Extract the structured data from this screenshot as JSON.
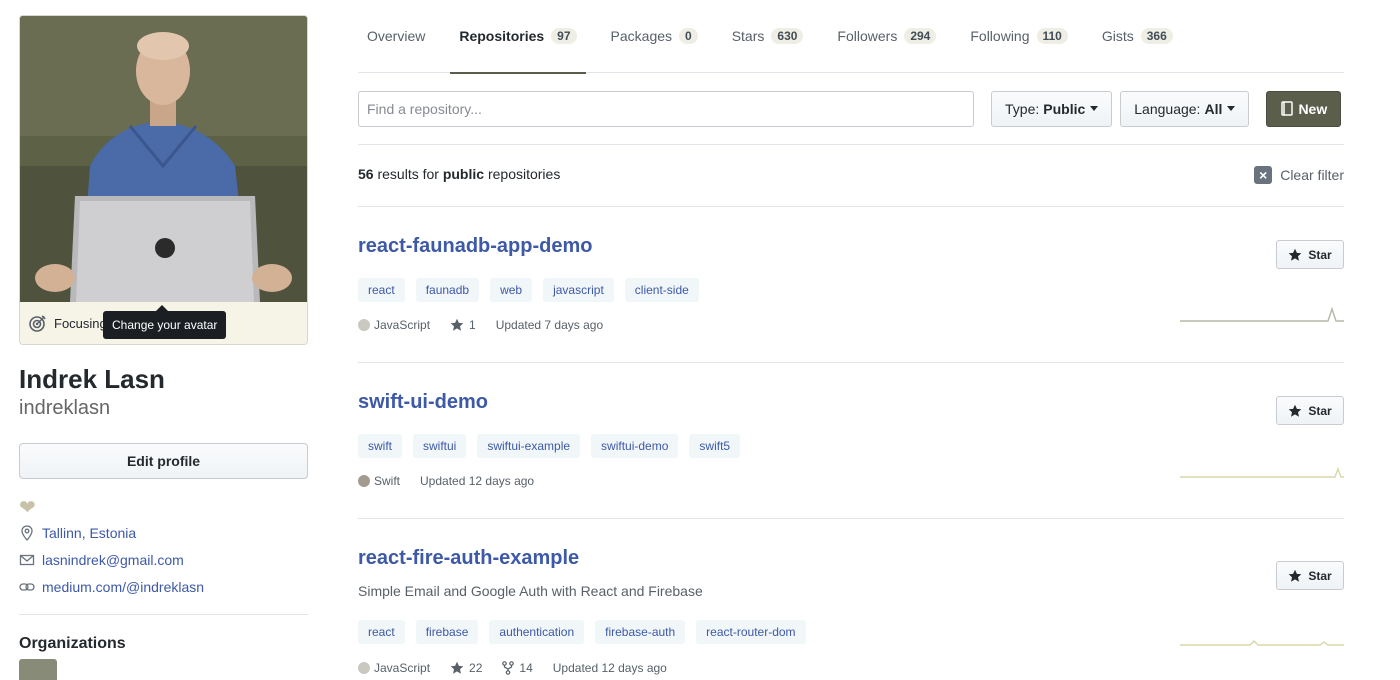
{
  "sidebar": {
    "status_text": "Focusing",
    "tooltip": "Change your avatar",
    "fullname": "Indrek Lasn",
    "username": "indreklasn",
    "edit_profile": "Edit profile",
    "heart_icon": "heart",
    "location": "Tallinn, Estonia",
    "email": "lasnindrek@gmail.com",
    "website": "medium.com/@indreklasn",
    "organizations_title": "Organizations"
  },
  "tabs": [
    {
      "label": "Overview",
      "count": null
    },
    {
      "label": "Repositories",
      "count": "97"
    },
    {
      "label": "Packages",
      "count": "0"
    },
    {
      "label": "Stars",
      "count": "630"
    },
    {
      "label": "Followers",
      "count": "294"
    },
    {
      "label": "Following",
      "count": "110"
    },
    {
      "label": "Gists",
      "count": "366"
    }
  ],
  "active_tab": "Repositories",
  "filter": {
    "search_placeholder": "Find a repository...",
    "type_label": "Type:",
    "type_value": "Public",
    "language_label": "Language:",
    "language_value": "All",
    "new_label": "New"
  },
  "results": {
    "count": "56",
    "mid": "results for",
    "kind": "public",
    "tail": "repositories",
    "clear_filter": "Clear filter"
  },
  "repos": [
    {
      "name": "react-faunadb-app-demo",
      "description": "",
      "topics": [
        "react",
        "faunadb",
        "web",
        "javascript",
        "client-side"
      ],
      "language": "JavaScript",
      "language_color": "#c9c8c1",
      "stars": "1",
      "forks": "",
      "updated": "Updated 7 days ago",
      "star_label": "Star"
    },
    {
      "name": "swift-ui-demo",
      "description": "",
      "topics": [
        "swift",
        "swiftui",
        "swiftui-example",
        "swiftui-demo",
        "swift5"
      ],
      "language": "Swift",
      "language_color": "#a39b8f",
      "stars": "",
      "forks": "",
      "updated": "Updated 12 days ago",
      "star_label": "Star"
    },
    {
      "name": "react-fire-auth-example",
      "description": "Simple Email and Google Auth with React and Firebase",
      "topics": [
        "react",
        "firebase",
        "authentication",
        "firebase-auth",
        "react-router-dom"
      ],
      "language": "JavaScript",
      "language_color": "#c9c8c1",
      "stars": "22",
      "forks": "14",
      "updated": "Updated 12 days ago",
      "star_label": "Star"
    }
  ],
  "colors": {
    "link": "#3d59a7",
    "accent": "#5b5e4b",
    "topic_bg": "#f1f6f9"
  }
}
